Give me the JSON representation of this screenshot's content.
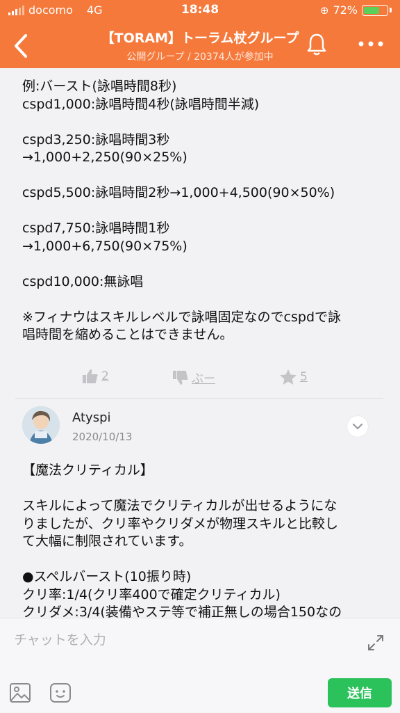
{
  "status": {
    "carrier": "docomo",
    "network": "4G",
    "time": "18:48",
    "battery": "72%",
    "battery_level": 0.72,
    "battery_color": "#5ad05a"
  },
  "header": {
    "title": "【TORAM】トーラム杖グループ",
    "subtitle": "公開グループ / 20374人が参加中",
    "bg_color": "#f5793b"
  },
  "post": {
    "lines": [
      "例:バースト(詠唱時間8秒)",
      "cspd1,000:詠唱時間4秒(詠唱時間半減)",
      "",
      "cspd3,250:詠唱時間3秒",
      "→1,000+2,250(90×25%)",
      "",
      "cspd5,500:詠唱時間2秒→1,000+4,500(90×50%)",
      "",
      "cspd7,750:詠唱時間1秒",
      "→1,000+6,750(90×75%)",
      "",
      "cspd10,000:無詠唱",
      "",
      "※フィナウはスキルレベルで詠唱固定なのでcspdで詠",
      "唱時間を縮めることはできません。"
    ],
    "likes": "2",
    "dislike_label": "ぶー",
    "stars": "5"
  },
  "comment": {
    "author": "Atyspi",
    "date": "2020/10/13",
    "lines": [
      "【魔法クリティカル】",
      "",
      "スキルによって魔法でクリティカルが出せるようにな",
      "りましたが、クリ率やクリダメが物理スキルと比較し",
      "て大幅に制限されています。",
      "",
      "●スペルバースト(10振り時)",
      "クリ率:1/4(クリ率400で確定クリティカル)",
      "クリダメ:3/4(装備やステ等で補正無しの場合150なの"
    ]
  },
  "input": {
    "placeholder": "チャットを入力",
    "send_label": "送信",
    "send_color": "#2bc15b"
  }
}
